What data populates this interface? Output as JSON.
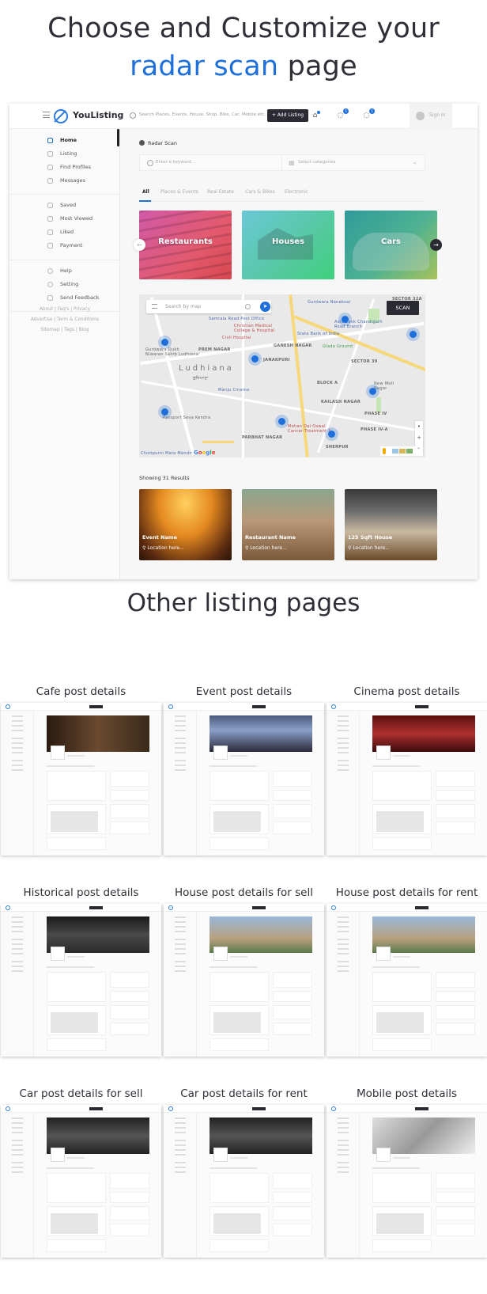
{
  "hero": {
    "line1": "Choose and Customize your",
    "accent": "radar scan",
    "line2_rest": " page",
    "accent_color": "#1e6fd9"
  },
  "app": {
    "logo": "YouListing",
    "search_placeholder": "Search Places, Events, House, Shop, Bike, Car, Mobile etc...",
    "add_listing": "+ Add Listing",
    "icons": [
      {
        "name": "store-icon",
        "glyph": "⌂",
        "badge": ""
      },
      {
        "name": "chat-icon",
        "glyph": "💬",
        "badge": "5"
      },
      {
        "name": "notification-icon",
        "glyph": "💬",
        "badge": "5"
      }
    ],
    "sign_in": "Sign In",
    "sidebar": {
      "group1": [
        {
          "label": "Home",
          "icon": "home-icon",
          "active": true
        },
        {
          "label": "Listing",
          "icon": "grid-icon"
        },
        {
          "label": "Find Profiles",
          "icon": "flag-icon"
        },
        {
          "label": "Messages",
          "icon": "message-icon"
        }
      ],
      "group2": [
        {
          "label": "Saved",
          "icon": "heart-icon"
        },
        {
          "label": "Most Viewed",
          "icon": "eye-icon"
        },
        {
          "label": "Liked",
          "icon": "flag-icon"
        },
        {
          "label": "Payment",
          "icon": "card-icon"
        }
      ],
      "group3": [
        {
          "label": "Help",
          "icon": "info-icon"
        },
        {
          "label": "Setting",
          "icon": "gear-icon"
        },
        {
          "label": "Send Feedback",
          "icon": "feedback-icon"
        }
      ],
      "footer_links": [
        "About | Faq's | Privacy",
        "Advertise | Term & Conditions",
        "Sitemap | Tags | Blog"
      ]
    },
    "main": {
      "title": "Radar Scan",
      "keyword_placeholder": "Enter a keyword...",
      "category_placeholder": "Select categories",
      "tabs": [
        "All",
        "Places & Events",
        "Real Estate",
        "Cars & Bikes",
        "Electronic"
      ],
      "active_tab": "All",
      "categories": [
        "Restaurants",
        "Houses",
        "Cars"
      ],
      "map": {
        "search_placeholder": "Search by map",
        "scan_label": "SCAN",
        "city": "Ludhiana",
        "city_local": "ਲੁਧਿਆਣਾ",
        "labels": [
          "Samrala Road Post Office",
          "Christian Medical College & Hospital",
          "Civil Hospital",
          "PREM NAGAR",
          "GANESH NAGAR",
          "JANAKPURI",
          "Gurdwara Dukh Niwaran Sahib Ludhiana",
          "Manju Cinema",
          "Passport Seva Kendra",
          "PARBHAT NAGAR",
          "Gurdwara Nanaksar",
          "Axis Bank Chandigarh Road Branch",
          "State Bank of India",
          "Glada Ground",
          "SECTOR 39",
          "SECTOR 32A",
          "BLOCK A",
          "New Moti Nagar",
          "KAILASH NAGAR",
          "PHASE IV",
          "PHASE IV-A",
          "Mohan Dai Oswal Cancer Treatment &",
          "SHERPUR",
          "Chintpurni Mata Mandir"
        ],
        "zoom_controls": [
          "•",
          "+",
          "−"
        ]
      },
      "results_title": "Showing 31 Results",
      "results": [
        {
          "name": "Event Name",
          "location": "Location here..."
        },
        {
          "name": "Restaurant Name",
          "location": "Location here..."
        },
        {
          "name": "125 Sqft House",
          "location": "Location here..."
        }
      ]
    }
  },
  "other": {
    "title": "Other listing pages",
    "pages": [
      "Cafe post details",
      "Event post details",
      "Cinema post details",
      "Historical post details",
      "House post details for sell",
      "House post details for rent",
      "Car post details for sell",
      "Car post details for rent",
      "Mobile post details"
    ]
  }
}
